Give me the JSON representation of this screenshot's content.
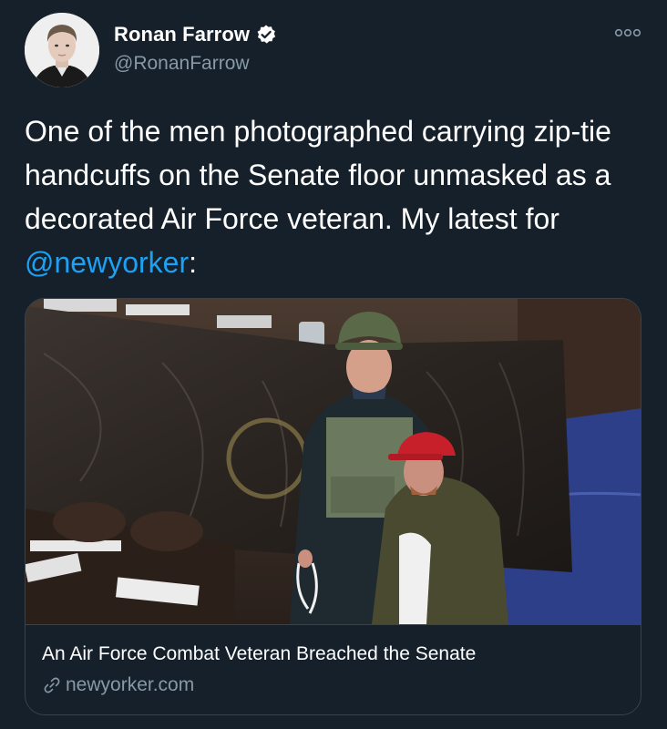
{
  "author": {
    "display_name": "Ronan Farrow",
    "handle": "@RonanFarrow",
    "avatar_icon": "profile-photo",
    "verified": true
  },
  "tweet": {
    "text_before_mention": "One of the men photographed carrying zip-tie handcuffs on the Senate floor unmasked as a decorated Air Force veteran. My latest for ",
    "mention": "@newyorker",
    "text_after_mention": ":"
  },
  "card": {
    "title": "An Air Force Combat Veteran Breached the Senate",
    "domain": "newyorker.com",
    "domain_icon": "link-icon",
    "image_description_icon": "article-photo"
  },
  "colors": {
    "background": "#15202b",
    "text": "#ffffff",
    "secondary_text": "#8899a6",
    "accent": "#1da1f2",
    "border": "#38444d"
  }
}
